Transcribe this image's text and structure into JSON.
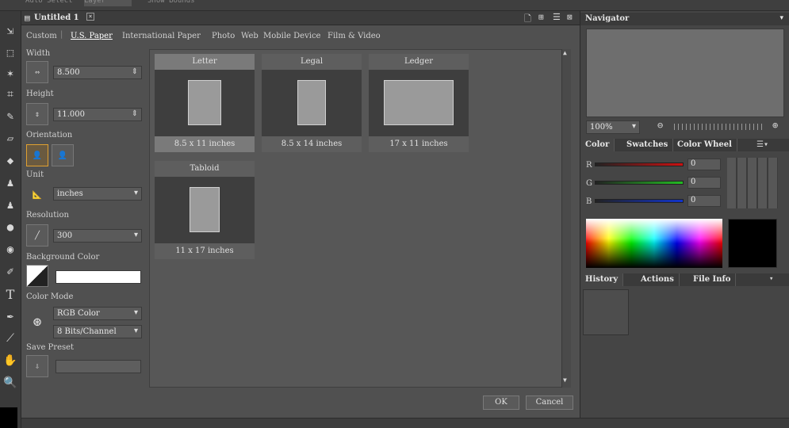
{
  "topbar": {
    "auto_select": "Auto Select",
    "layer": "Layer",
    "show_bounds": "Show Bounds"
  },
  "document": {
    "tab_title": "Untitled 1"
  },
  "categories": [
    "Custom",
    "U.S. Paper",
    "International Paper",
    "Photo",
    "Web",
    "Mobile Device",
    "Film & Video"
  ],
  "fields": {
    "width_label": "Width",
    "width_value": "8.500",
    "height_label": "Height",
    "height_value": "11.000",
    "orientation_label": "Orientation",
    "unit_label": "Unit",
    "unit_value": "inches",
    "resolution_label": "Resolution",
    "resolution_value": "300",
    "bg_label": "Background Color",
    "color_mode_label": "Color Mode",
    "color_mode_value": "RGB Color",
    "bits_value": "8 Bits/Channel",
    "save_preset_label": "Save Preset"
  },
  "presets": [
    {
      "name": "Letter",
      "size": "8.5 x 11 inches"
    },
    {
      "name": "Legal",
      "size": "8.5 x 14 inches"
    },
    {
      "name": "Ledger",
      "size": "17 x 11 inches"
    },
    {
      "name": "Tabloid",
      "size": "11 x 17 inches"
    }
  ],
  "buttons": {
    "ok": "OK",
    "cancel": "Cancel"
  },
  "navigator": {
    "title": "Navigator",
    "zoom": "100%"
  },
  "color_panel": {
    "tabs": [
      "Color",
      "Swatches",
      "Color Wheel"
    ],
    "r_label": "R",
    "g_label": "G",
    "b_label": "B",
    "r_value": "0",
    "g_value": "0",
    "b_value": "0",
    "r_color": "#cc1111",
    "g_color": "#22bb22",
    "b_color": "#1133cc"
  },
  "history_panel": {
    "tabs": [
      "History",
      "Actions",
      "File Info"
    ]
  }
}
